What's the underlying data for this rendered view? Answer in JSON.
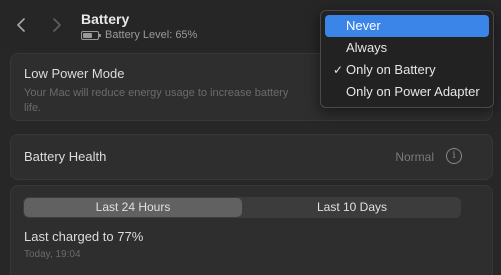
{
  "header": {
    "title": "Battery",
    "battery_level": "Battery Level: 65%"
  },
  "low_power_mode": {
    "label": "Low Power Mode",
    "description": "Your Mac will reduce energy usage to increase battery life."
  },
  "battery_health": {
    "label": "Battery Health",
    "value": "Normal",
    "info_glyph": "i"
  },
  "usage": {
    "tabs": [
      {
        "label": "Last 24 Hours",
        "active": true
      },
      {
        "label": "Last 10 Days",
        "active": false
      }
    ],
    "last_charged": "Last charged to 77%",
    "last_charged_time": "Today, 19:04"
  },
  "dropdown": {
    "items": [
      {
        "label": "Never",
        "highlighted": true,
        "checked": false
      },
      {
        "label": "Always",
        "highlighted": false,
        "checked": false
      },
      {
        "label": "Only on Battery",
        "highlighted": false,
        "checked": true
      },
      {
        "label": "Only on Power Adapter",
        "highlighted": false,
        "checked": false
      }
    ],
    "check_glyph": "✓"
  },
  "colors": {
    "accent": "#3b84e8",
    "background": "#282728"
  }
}
